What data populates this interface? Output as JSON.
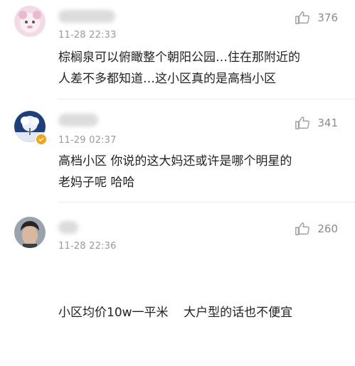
{
  "comments": [
    {
      "avatar": "pink-cartoon-avatar",
      "time": "11-28 22:33",
      "likes": "376",
      "lines": [
        "棕榈泉可以俯瞰整个朝阳公园…住在那附近的",
        "人差不多都知道…这小区真的是高档小区"
      ]
    },
    {
      "avatar": "snowy-tree-avatar",
      "verified_badge": true,
      "time": "11-29 02:37",
      "likes": "341",
      "lines": [
        "高档小区 你说的这大妈还或许是哪个明星的",
        "老妈子呢 哈哈"
      ]
    },
    {
      "avatar": "man-portrait-avatar",
      "time": "11-28 22:36",
      "likes": "260",
      "lines": [
        "小区均价10w一平米    大户型的话也不便宜"
      ]
    }
  ],
  "colors": {
    "text": "#222222",
    "meta": "#9a9a9a",
    "like_icon": "#a0a0a0",
    "divider": "#ececec",
    "badge": "#f2a21b"
  }
}
